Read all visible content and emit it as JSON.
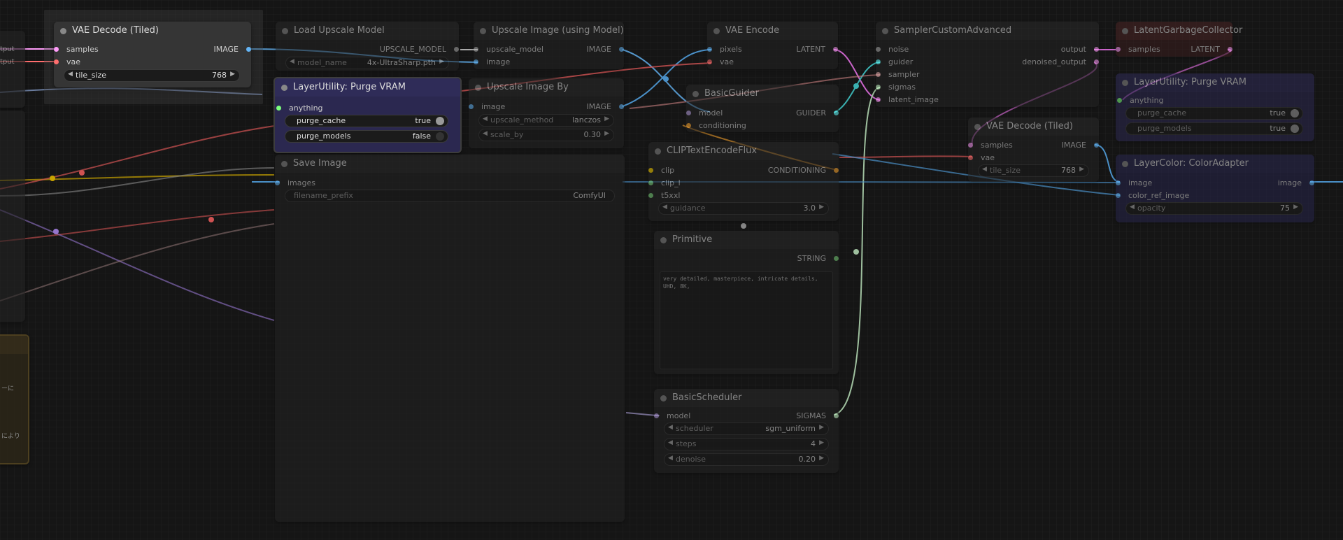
{
  "colors": {
    "IMAGE": "#64b5f6",
    "LATENT": "#ff9cf9",
    "VAE": "#ff6e6e",
    "CONDITIONING": "#ffa931",
    "CLIP": "#ffd500",
    "STRING": "#7cd37c",
    "SIGMAS": "#cdffcd",
    "MODEL": "#b39ddb",
    "UPSCALE_MODEL": "#b0b0b0",
    "NOISE": "#b0b0b0",
    "GUIDER": "#66ffff",
    "SAMPLER": "#ecb4b4",
    "ANY": "#7cff7c",
    "accent_purple_node": "#2b2850",
    "accent_red_node": "#3a1e1e"
  },
  "left_fragments": {
    "out1": "tput",
    "out2": "tput",
    "jp1": "ーに",
    "jp2": "により"
  },
  "nodes": {
    "vae_decode_tiled_1": {
      "title": "VAE Decode (Tiled)",
      "in_samples": "samples",
      "in_vae": "vae",
      "out_image": "IMAGE",
      "w_tile_size_label": "tile_size",
      "w_tile_size_value": "768"
    },
    "load_upscale_model": {
      "title": "Load Upscale Model",
      "out": "UPSCALE_MODEL",
      "w_model_name_label": "model_name",
      "w_model_name_value": "4x-UltraSharp.pth"
    },
    "upscale_image_using_model": {
      "title": "Upscale Image (using Model)",
      "in_upscale_model": "upscale_model",
      "in_image": "image",
      "out_image": "IMAGE"
    },
    "layer_utility_purge_vram_1": {
      "title": "LayerUtility: Purge VRAM",
      "in_anything": "anything",
      "w_purge_cache_label": "purge_cache",
      "w_purge_cache_value": "true",
      "w_purge_models_label": "purge_models",
      "w_purge_models_value": "false"
    },
    "upscale_image_by": {
      "title": "Upscale Image By",
      "in_image": "image",
      "out_image": "IMAGE",
      "w_upscale_method_label": "upscale_method",
      "w_upscale_method_value": "lanczos",
      "w_scale_by_label": "scale_by",
      "w_scale_by_value": "0.30"
    },
    "save_image": {
      "title": "Save Image",
      "in_images": "images",
      "w_filename_prefix_label": "filename_prefix",
      "w_filename_prefix_value": "ComfyUI"
    },
    "vae_encode": {
      "title": "VAE Encode",
      "in_pixels": "pixels",
      "in_vae": "vae",
      "out_latent": "LATENT"
    },
    "basic_guider": {
      "title": "BasicGuider",
      "in_model": "model",
      "in_conditioning": "conditioning",
      "out_guider": "GUIDER"
    },
    "clip_text_encode_flux": {
      "title": "CLIPTextEncodeFlux",
      "in_clip": "clip",
      "in_clip_l": "clip_l",
      "in_t5xxl": "t5xxl",
      "out_conditioning": "CONDITIONING",
      "w_guidance_label": "guidance",
      "w_guidance_value": "3.0"
    },
    "primitive": {
      "title": "Primitive",
      "out_string": "STRING",
      "text": "very detailed, masterpiece, intricate details,\nUHD, 8K,"
    },
    "basic_scheduler": {
      "title": "BasicScheduler",
      "in_model": "model",
      "out_sigmas": "SIGMAS",
      "w_scheduler_label": "scheduler",
      "w_scheduler_value": "sgm_uniform",
      "w_steps_label": "steps",
      "w_steps_value": "4",
      "w_denoise_label": "denoise",
      "w_denoise_value": "0.20"
    },
    "sampler_custom_advanced": {
      "title": "SamplerCustomAdvanced",
      "in_noise": "noise",
      "in_guider": "guider",
      "in_sampler": "sampler",
      "in_sigmas": "sigmas",
      "in_latent_image": "latent_image",
      "out_output": "output",
      "out_denoised_output": "denoised_output"
    },
    "vae_decode_tiled_2": {
      "title": "VAE Decode (Tiled)",
      "in_samples": "samples",
      "in_vae": "vae",
      "out_image": "IMAGE",
      "w_tile_size_label": "tile_size",
      "w_tile_size_value": "768"
    },
    "latent_garbage_collector": {
      "title": "LatentGarbageCollector",
      "in_samples": "samples",
      "out_latent": "LATENT"
    },
    "layer_utility_purge_vram_2": {
      "title": "LayerUtility: Purge VRAM",
      "in_anything": "anything",
      "w_purge_cache_label": "purge_cache",
      "w_purge_cache_value": "true",
      "w_purge_models_label": "purge_models",
      "w_purge_models_value": "true"
    },
    "layer_color_adapter": {
      "title": "LayerColor: ColorAdapter",
      "in_image": "image",
      "in_color_ref_image": "color_ref_image",
      "out_image": "image",
      "w_opacity_label": "opacity",
      "w_opacity_value": "75"
    }
  }
}
